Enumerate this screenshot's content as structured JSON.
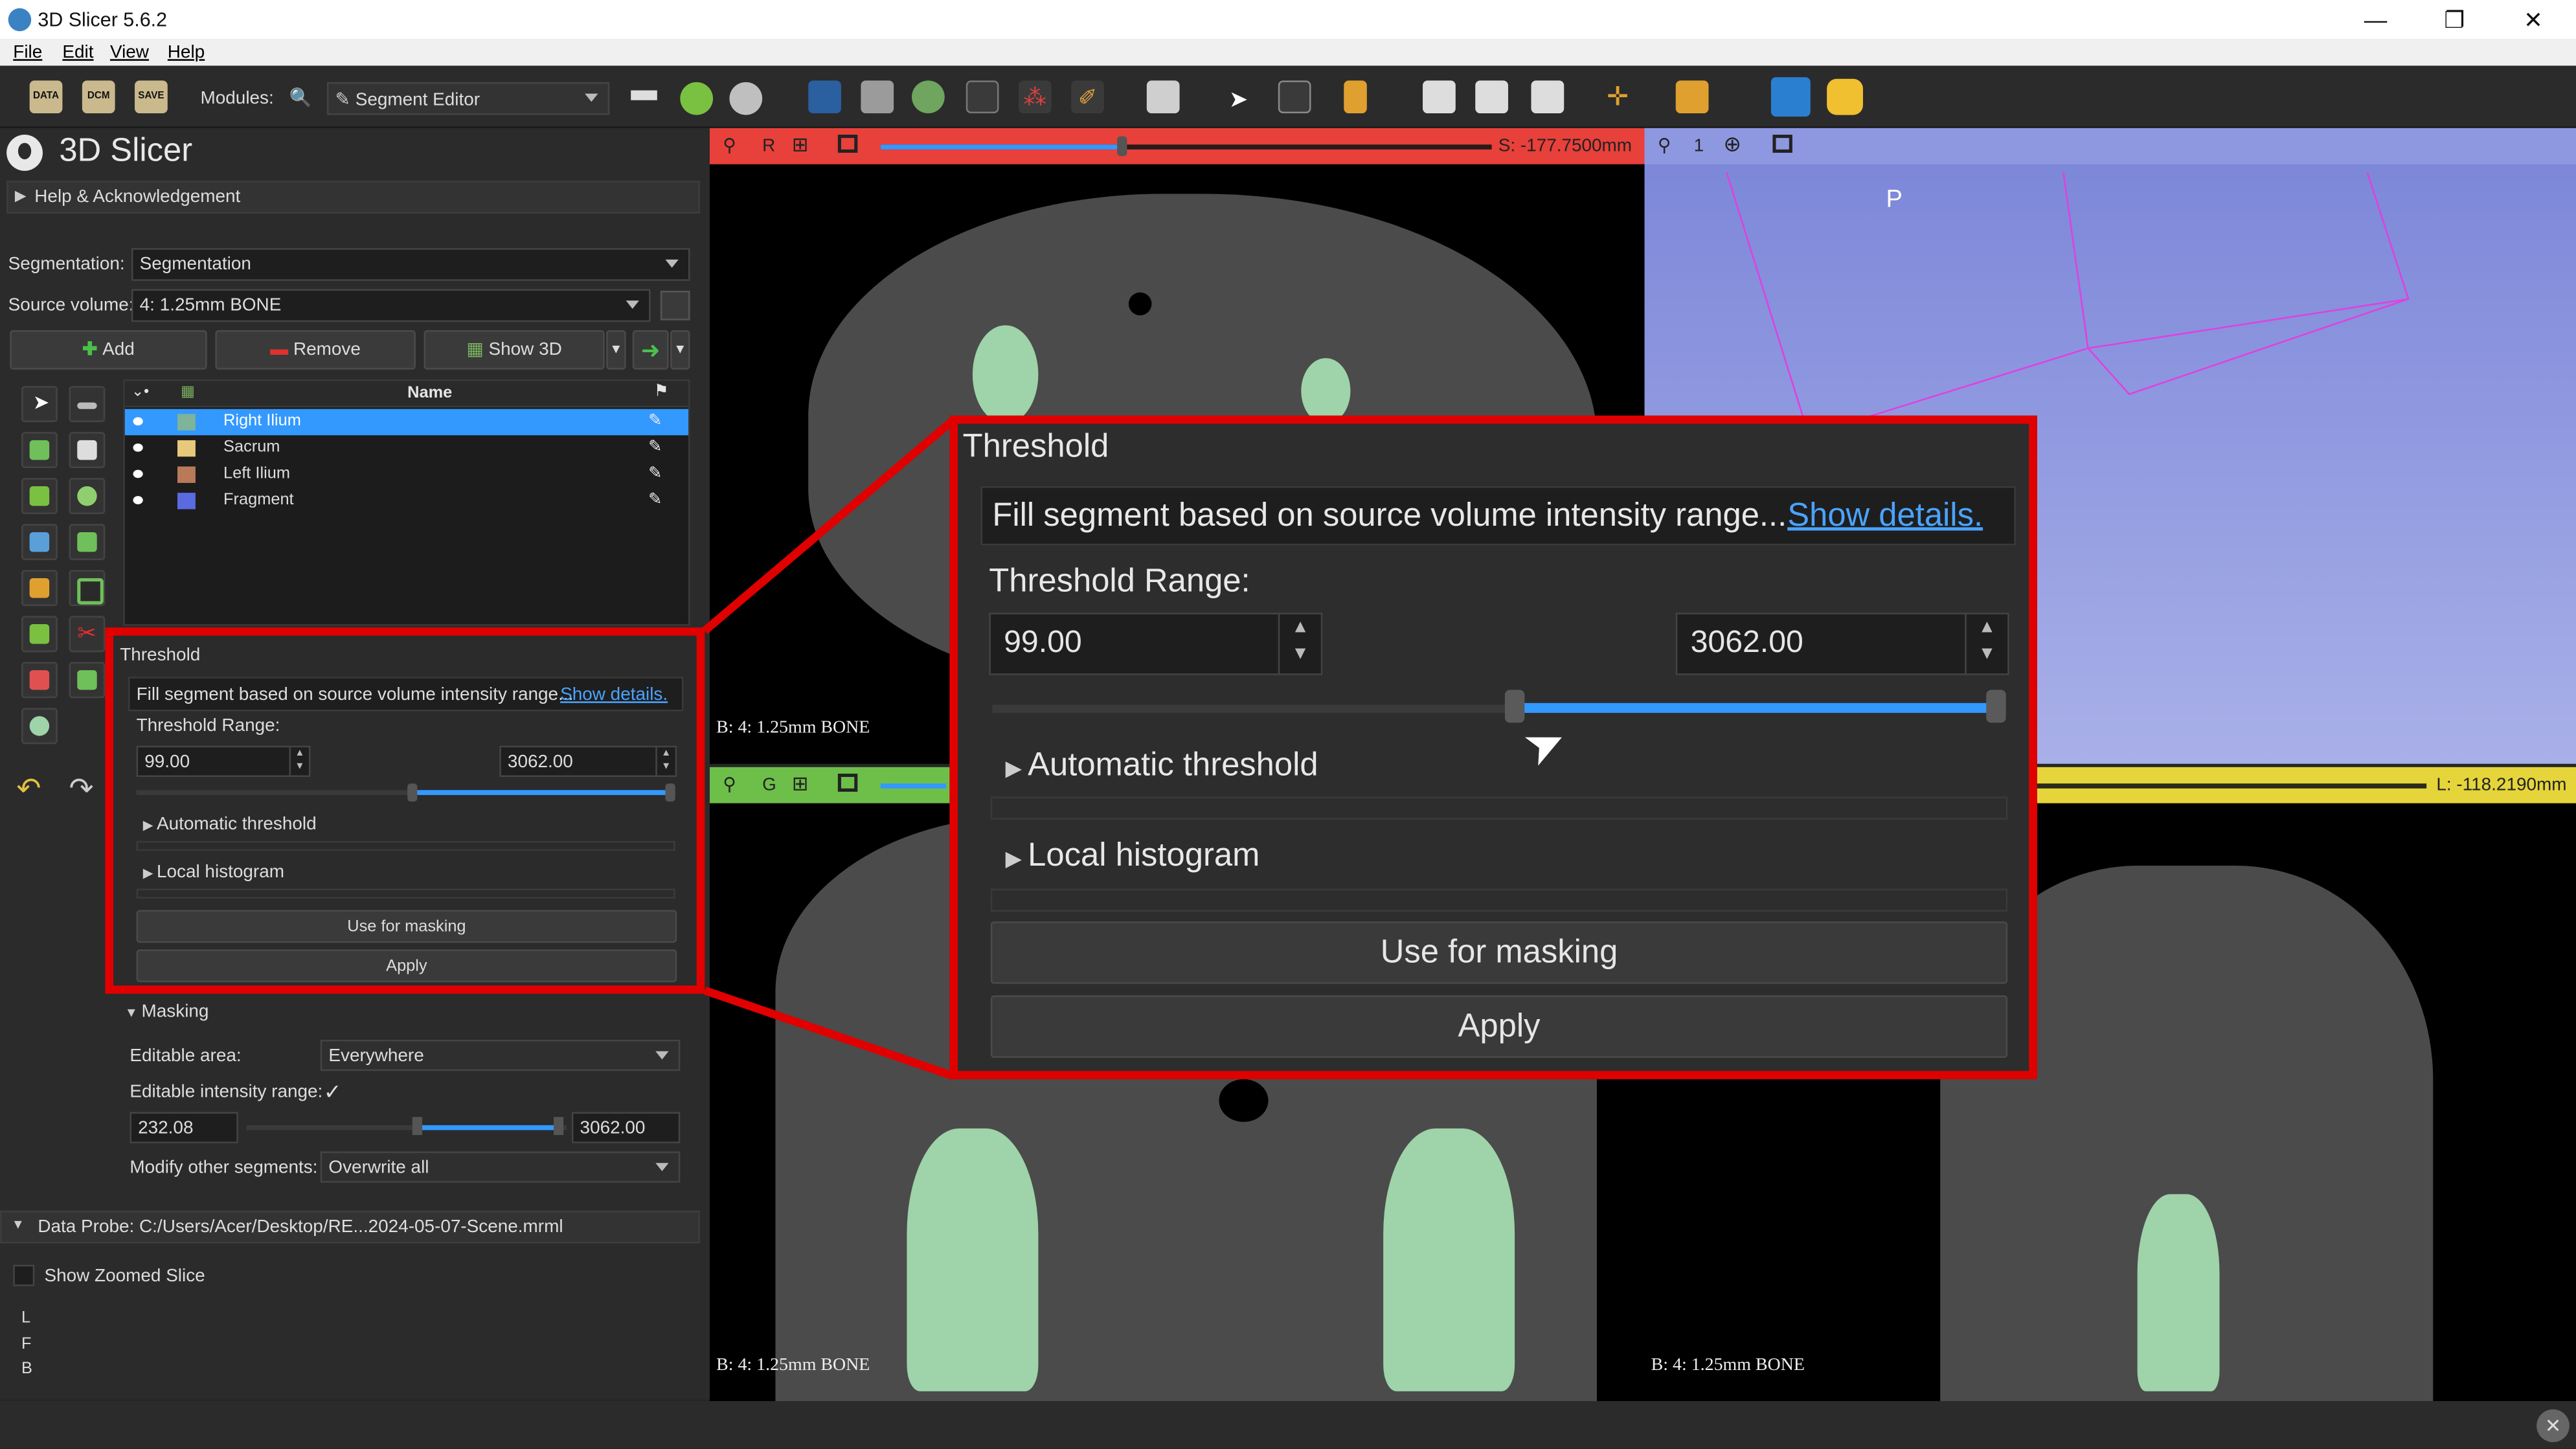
{
  "window": {
    "title": "3D Slicer 5.6.2",
    "minimize": "—",
    "restore": "❐",
    "close": "✕"
  },
  "menu": [
    "File",
    "Edit",
    "View",
    "Help"
  ],
  "toolbar": {
    "data_label": "DATA",
    "dcm_label": "DCM",
    "save_label": "SAVE",
    "modules_label": "Modules:",
    "module_selected": "Segment Editor"
  },
  "brand": "3D Slicer",
  "help_section": "Help & Acknowledgement",
  "segmentation": {
    "label": "Segmentation:",
    "value": "Segmentation"
  },
  "source_volume": {
    "label": "Source volume:",
    "value": "4: 1.25mm BONE"
  },
  "buttons": {
    "add": "Add",
    "remove": "Remove",
    "show3d": "Show 3D"
  },
  "segment_table": {
    "name_header": "Name",
    "rows": [
      {
        "name": "Right Ilium",
        "color": "#7fb39a"
      },
      {
        "name": "Sacrum",
        "color": "#e8c87a"
      },
      {
        "name": "Left Ilium",
        "color": "#b97a5a"
      },
      {
        "name": "Fragment",
        "color": "#5a6ae0"
      }
    ]
  },
  "threshold": {
    "title": "Threshold",
    "description": "Fill segment based on source volume intensity range...",
    "show_details": "Show details.",
    "range_label": "Threshold Range:",
    "min": "99.00",
    "max": "3062.00",
    "auto_threshold": "Automatic threshold",
    "local_histogram": "Local histogram",
    "use_for_masking": "Use for masking",
    "apply": "Apply"
  },
  "masking": {
    "title": "Masking",
    "editable_area_label": "Editable area:",
    "editable_area_value": "Everywhere",
    "editable_intensity_label": "Editable intensity range:",
    "editable_intensity_check": "✓",
    "min": "232.08",
    "max": "3062.00",
    "modify_other_label": "Modify other segments:",
    "modify_other_value": "Overwrite all"
  },
  "data_probe": "Data Probe: C:/Users/Acer/Desktop/RE...2024-05-07-Scene.mrml",
  "show_zoomed_slice": "Show Zoomed Slice",
  "probe_letters": [
    "L",
    "F",
    "B"
  ],
  "views": {
    "red": {
      "letter": "R",
      "offset": "S: -177.7500mm",
      "volume_label": "B: 4: 1.25mm BONE"
    },
    "threed": {
      "number": "1",
      "orientation": "P"
    },
    "green": {
      "letter": "G",
      "volume_label": "B: 4: 1.25mm BONE"
    },
    "yellow": {
      "offset": "L: -118.2190mm",
      "volume_label": "B: 4: 1.25mm BONE"
    }
  },
  "colors": {
    "accent": "#3399ff",
    "highlight_red": "#e00000",
    "red_view": "#e8403a",
    "green_view": "#6dbf4a",
    "yellow_view": "#e5d53a",
    "bone": "#9fd3a9"
  }
}
